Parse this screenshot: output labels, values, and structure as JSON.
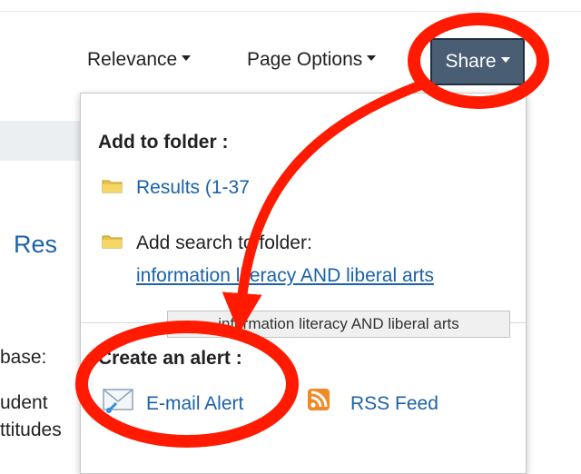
{
  "toolbar": {
    "sort_label": "Relevance",
    "page_options_label": "Page Options",
    "share_label": "Share"
  },
  "background": {
    "heading_fragment": "Res",
    "database_fragment": "base:",
    "student_fragment": "udent",
    "attitudes_fragment": "ttitudes"
  },
  "share_menu": {
    "add_to_folder_heading": "Add to folder :",
    "results_link": "Results (1-37",
    "add_search_text": "Add search to folder:",
    "search_query_link": "information literacy AND liberal arts",
    "tooltip_text": "information literacy AND liberal arts",
    "create_alert_heading": "Create an alert :",
    "email_alert_label": "E-mail Alert",
    "rss_feed_label": "RSS Feed"
  },
  "annotations": {
    "highlight_color": "#ff1a00"
  }
}
